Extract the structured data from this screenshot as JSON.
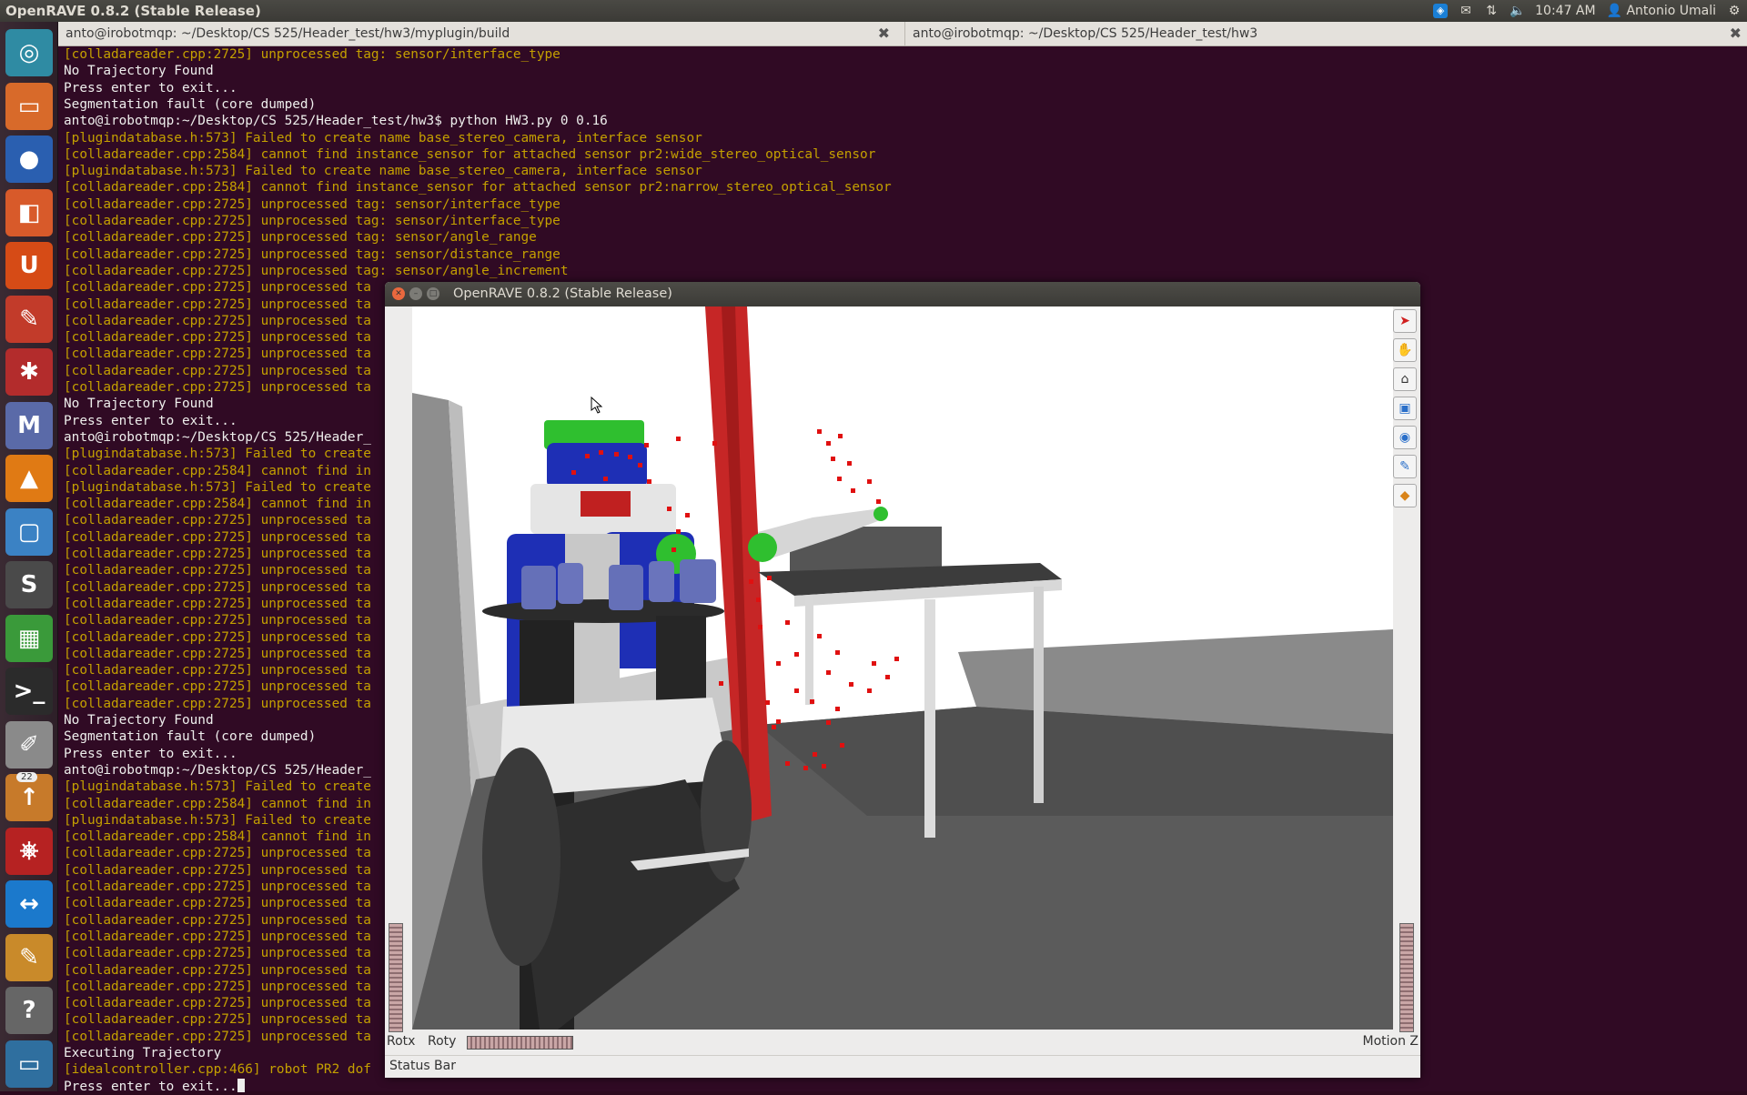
{
  "top_panel": {
    "app_title": "OpenRAVE 0.8.2 (Stable Release)",
    "clock": "10:47 AM",
    "user": "Antonio Umali",
    "icons": [
      "dropbox-icon",
      "mail-icon",
      "network-icon",
      "volume-icon",
      "power-gear-icon"
    ]
  },
  "launcher": {
    "items": [
      {
        "name": "dash-home",
        "icon": "ubuntu-logo-icon",
        "glyph": "◎",
        "color": "#2f8ba3"
      },
      {
        "name": "files",
        "icon": "folder-icon",
        "glyph": "▭",
        "color": "#d86a2a"
      },
      {
        "name": "firefox",
        "icon": "firefox-icon",
        "glyph": "●",
        "color": "#2a5fb0"
      },
      {
        "name": "software-center",
        "icon": "shopping-bag-icon",
        "glyph": "◧",
        "color": "#d85a2a"
      },
      {
        "name": "ubuntu-one",
        "icon": "ubuntu-one-icon",
        "glyph": "U",
        "color": "#d64b16"
      },
      {
        "name": "system-settings",
        "icon": "settings-icon",
        "glyph": "✎",
        "color": "#c23b2a"
      },
      {
        "name": "synaptic",
        "icon": "synaptic-icon",
        "glyph": "✱",
        "color": "#b32c2c"
      },
      {
        "name": "maple",
        "icon": "maple-icon",
        "glyph": "M",
        "color": "#5a6aa8"
      },
      {
        "name": "vlc",
        "icon": "vlc-icon",
        "glyph": "▲",
        "color": "#e07a14"
      },
      {
        "name": "screenshot",
        "icon": "screenshot-icon",
        "glyph": "▢",
        "color": "#3b82c4"
      },
      {
        "name": "sublime-text",
        "icon": "sublime-icon",
        "glyph": "S",
        "color": "#4a4a4a"
      },
      {
        "name": "workspaces",
        "icon": "workspace-switcher-icon",
        "glyph": "▦",
        "color": "#3a9a3a"
      },
      {
        "name": "terminal",
        "icon": "terminal-icon",
        "glyph": ">_",
        "color": "#2b2b2b"
      },
      {
        "name": "text-editor",
        "icon": "text-editor-icon",
        "glyph": "✐",
        "color": "#8a8a8a"
      },
      {
        "name": "updates",
        "icon": "update-manager-icon",
        "glyph": "↑",
        "color": "#c77a2a",
        "badge": "22"
      },
      {
        "name": "pdf-viewer",
        "icon": "pdf-icon",
        "glyph": "⎈",
        "color": "#b62222"
      },
      {
        "name": "teamviewer",
        "icon": "teamviewer-icon",
        "glyph": "↔",
        "color": "#1b79cc"
      },
      {
        "name": "notes",
        "icon": "notes-icon",
        "glyph": "✎",
        "color": "#c98a2a"
      },
      {
        "name": "help",
        "icon": "help-icon",
        "glyph": "?",
        "color": "#666666"
      },
      {
        "name": "remote-desktop",
        "icon": "remote-desktop-icon",
        "glyph": "▭",
        "color": "#2f6f9f"
      }
    ]
  },
  "terminal_tabs": [
    {
      "title": "anto@irobotmqp: ~/Desktop/CS 525/Header_test/hw3/myplugin/build"
    },
    {
      "title": "anto@irobotmqp: ~/Desktop/CS 525/Header_test/hw3"
    }
  ],
  "terminal": {
    "lines": [
      {
        "text": "[colladareader.cpp:2725] unprocessed tag: sensor/interface_type",
        "color": "yellow"
      },
      {
        "text": "No Trajectory Found",
        "color": "white"
      },
      {
        "text": "Press enter to exit...",
        "color": "white"
      },
      {
        "text": "Segmentation fault (core dumped)",
        "color": "white"
      },
      {
        "text": "anto@irobotmqp:~/Desktop/CS 525/Header_test/hw3$ python HW3.py 0 0.16",
        "color": "white"
      },
      {
        "text": "[plugindatabase.h:573] Failed to create name base_stereo_camera, interface sensor",
        "color": "yellow"
      },
      {
        "text": "[colladareader.cpp:2584] cannot find instance_sensor for attached sensor pr2:wide_stereo_optical_sensor",
        "color": "yellow"
      },
      {
        "text": "[plugindatabase.h:573] Failed to create name base_stereo_camera, interface sensor",
        "color": "yellow"
      },
      {
        "text": "[colladareader.cpp:2584] cannot find instance_sensor for attached sensor pr2:narrow_stereo_optical_sensor",
        "color": "yellow"
      },
      {
        "text": "[colladareader.cpp:2725] unprocessed tag: sensor/interface_type",
        "color": "yellow"
      },
      {
        "text": "[colladareader.cpp:2725] unprocessed tag: sensor/interface_type",
        "color": "yellow"
      },
      {
        "text": "[colladareader.cpp:2725] unprocessed tag: sensor/angle_range",
        "color": "yellow"
      },
      {
        "text": "[colladareader.cpp:2725] unprocessed tag: sensor/distance_range",
        "color": "yellow"
      },
      {
        "text": "[colladareader.cpp:2725] unprocessed tag: sensor/angle_increment",
        "color": "yellow"
      },
      {
        "text": "[colladareader.cpp:2725] unprocessed ta",
        "color": "yellow"
      },
      {
        "text": "[colladareader.cpp:2725] unprocessed ta",
        "color": "yellow"
      },
      {
        "text": "[colladareader.cpp:2725] unprocessed ta",
        "color": "yellow"
      },
      {
        "text": "[colladareader.cpp:2725] unprocessed ta",
        "color": "yellow"
      },
      {
        "text": "[colladareader.cpp:2725] unprocessed ta",
        "color": "yellow"
      },
      {
        "text": "[colladareader.cpp:2725] unprocessed ta",
        "color": "yellow"
      },
      {
        "text": "[colladareader.cpp:2725] unprocessed ta",
        "color": "yellow"
      },
      {
        "text": "No Trajectory Found",
        "color": "white"
      },
      {
        "text": "Press enter to exit...",
        "color": "white"
      },
      {
        "text": "anto@irobotmqp:~/Desktop/CS 525/Header_",
        "color": "white"
      },
      {
        "text": "[plugindatabase.h:573] Failed to create",
        "color": "yellow"
      },
      {
        "text": "[colladareader.cpp:2584] cannot find in",
        "color": "yellow"
      },
      {
        "text": "[plugindatabase.h:573] Failed to create",
        "color": "yellow"
      },
      {
        "text": "[colladareader.cpp:2584] cannot find in",
        "color": "yellow"
      },
      {
        "text": "[colladareader.cpp:2725] unprocessed ta",
        "color": "yellow"
      },
      {
        "text": "[colladareader.cpp:2725] unprocessed ta",
        "color": "yellow"
      },
      {
        "text": "[colladareader.cpp:2725] unprocessed ta",
        "color": "yellow"
      },
      {
        "text": "[colladareader.cpp:2725] unprocessed ta",
        "color": "yellow"
      },
      {
        "text": "[colladareader.cpp:2725] unprocessed ta",
        "color": "yellow"
      },
      {
        "text": "[colladareader.cpp:2725] unprocessed ta",
        "color": "yellow"
      },
      {
        "text": "[colladareader.cpp:2725] unprocessed ta",
        "color": "yellow"
      },
      {
        "text": "[colladareader.cpp:2725] unprocessed ta",
        "color": "yellow"
      },
      {
        "text": "[colladareader.cpp:2725] unprocessed ta",
        "color": "yellow"
      },
      {
        "text": "[colladareader.cpp:2725] unprocessed ta",
        "color": "yellow"
      },
      {
        "text": "[colladareader.cpp:2725] unprocessed ta",
        "color": "yellow"
      },
      {
        "text": "[colladareader.cpp:2725] unprocessed ta",
        "color": "yellow"
      },
      {
        "text": "No Trajectory Found",
        "color": "white"
      },
      {
        "text": "Segmentation fault (core dumped)",
        "color": "white"
      },
      {
        "text": "Press enter to exit...",
        "color": "white"
      },
      {
        "text": "anto@irobotmqp:~/Desktop/CS 525/Header_",
        "color": "white"
      },
      {
        "text": "[plugindatabase.h:573] Failed to create",
        "color": "yellow"
      },
      {
        "text": "[colladareader.cpp:2584] cannot find in",
        "color": "yellow"
      },
      {
        "text": "[plugindatabase.h:573] Failed to create",
        "color": "yellow"
      },
      {
        "text": "[colladareader.cpp:2584] cannot find in",
        "color": "yellow"
      },
      {
        "text": "[colladareader.cpp:2725] unprocessed ta",
        "color": "yellow"
      },
      {
        "text": "[colladareader.cpp:2725] unprocessed ta",
        "color": "yellow"
      },
      {
        "text": "[colladareader.cpp:2725] unprocessed ta",
        "color": "yellow"
      },
      {
        "text": "[colladareader.cpp:2725] unprocessed ta",
        "color": "yellow"
      },
      {
        "text": "[colladareader.cpp:2725] unprocessed ta",
        "color": "yellow"
      },
      {
        "text": "[colladareader.cpp:2725] unprocessed ta",
        "color": "yellow"
      },
      {
        "text": "[colladareader.cpp:2725] unprocessed ta",
        "color": "yellow"
      },
      {
        "text": "[colladareader.cpp:2725] unprocessed ta",
        "color": "yellow"
      },
      {
        "text": "[colladareader.cpp:2725] unprocessed ta",
        "color": "yellow"
      },
      {
        "text": "[colladareader.cpp:2725] unprocessed ta",
        "color": "yellow"
      },
      {
        "text": "[colladareader.cpp:2725] unprocessed ta",
        "color": "yellow"
      },
      {
        "text": "[colladareader.cpp:2725] unprocessed ta",
        "color": "yellow"
      },
      {
        "text": "Executing Trajectory",
        "color": "white"
      },
      {
        "text": "[idealcontroller.cpp:466] robot PR2 dof",
        "color": "yellow"
      },
      {
        "text": "Press enter to exit...",
        "color": "white",
        "cursor": true
      }
    ]
  },
  "openrave": {
    "title": "OpenRAVE 0.8.2 (Stable Release)",
    "rotx_label": "Rotx",
    "roty_label": "Roty",
    "motionz_label": "Motion Z",
    "status": "Status Bar",
    "tools": [
      {
        "name": "select-tool",
        "icon": "arrow-pointer-icon",
        "glyph": "➤",
        "color": "#d02020"
      },
      {
        "name": "pan-tool",
        "icon": "hand-icon",
        "glyph": "✋",
        "color": "#333333"
      },
      {
        "name": "home-view-tool",
        "icon": "home-icon",
        "glyph": "⌂",
        "color": "#333333"
      },
      {
        "name": "view-all-tool",
        "icon": "view-all-icon",
        "glyph": "▣",
        "color": "#2a6fc9"
      },
      {
        "name": "seek-tool",
        "icon": "eye-icon",
        "glyph": "◉",
        "color": "#2a6fc9"
      },
      {
        "name": "perspective-tool",
        "icon": "brush-icon",
        "glyph": "✎",
        "color": "#2a6fc9"
      },
      {
        "name": "camera-tool",
        "icon": "camera-cube-icon",
        "glyph": "◆",
        "color": "#d9841a"
      }
    ]
  }
}
